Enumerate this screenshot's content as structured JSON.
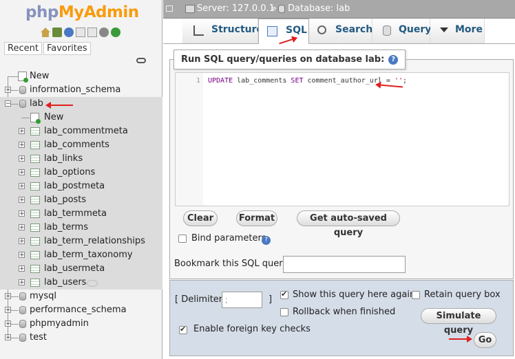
{
  "logo": {
    "part1": "php",
    "part2": "MyAdmin"
  },
  "nav": {
    "recent_label": "Recent",
    "favorites_label": "Favorites",
    "tree": [
      {
        "label": "New",
        "kind": "new",
        "level": 0
      },
      {
        "label": "information_schema",
        "kind": "db",
        "level": 0
      },
      {
        "label": "lab",
        "kind": "db",
        "level": 0,
        "selected": true
      },
      {
        "label": "New",
        "kind": "new",
        "level": 1
      },
      {
        "label": "lab_commentmeta",
        "kind": "table",
        "level": 1
      },
      {
        "label": "lab_comments",
        "kind": "table",
        "level": 1
      },
      {
        "label": "lab_links",
        "kind": "table",
        "level": 1
      },
      {
        "label": "lab_options",
        "kind": "table",
        "level": 1
      },
      {
        "label": "lab_postmeta",
        "kind": "table",
        "level": 1
      },
      {
        "label": "lab_posts",
        "kind": "table",
        "level": 1
      },
      {
        "label": "lab_termmeta",
        "kind": "table",
        "level": 1
      },
      {
        "label": "lab_terms",
        "kind": "table",
        "level": 1
      },
      {
        "label": "lab_term_relationships",
        "kind": "table",
        "level": 1
      },
      {
        "label": "lab_term_taxonomy",
        "kind": "table",
        "level": 1
      },
      {
        "label": "lab_usermeta",
        "kind": "table",
        "level": 1
      },
      {
        "label": "lab_users",
        "kind": "table",
        "level": 1
      },
      {
        "label": "mysql",
        "kind": "db",
        "level": 0
      },
      {
        "label": "performance_schema",
        "kind": "db",
        "level": 0
      },
      {
        "label": "phpmyadmin",
        "kind": "db",
        "level": 0
      },
      {
        "label": "test",
        "kind": "db",
        "level": 0
      }
    ]
  },
  "breadcrumb": {
    "server": "Server: 127.0.0.1",
    "separator": "»",
    "database": "Database: lab"
  },
  "tabs": [
    {
      "label": "Structure",
      "icon": "structure-icon"
    },
    {
      "label": "SQL",
      "icon": "sql-icon",
      "active": true
    },
    {
      "label": "Search",
      "icon": "search-icon"
    },
    {
      "label": "Query",
      "icon": "query-icon"
    },
    {
      "label": "More",
      "icon": "caret-down-icon"
    }
  ],
  "sql": {
    "legend": "Run SQL query/queries on database lab:",
    "line_number": "1",
    "code_keyword1": "UPDATE",
    "code_part1": " lab_comments ",
    "code_keyword2": "SET",
    "code_part2": " comment_author_url = ",
    "code_string": "''",
    "code_end": ";",
    "clear_label": "Clear",
    "format_label": "Format",
    "autosave_label": "Get auto-saved query",
    "bind_label": "Bind parameters",
    "bookmark_label": "Bookmark this SQL query:",
    "bookmark_value": ""
  },
  "options": {
    "delimiter_label": "[ Delimiter",
    "delimiter_close": "]",
    "delimiter_value": ";",
    "show_query_label": "Show this query here again",
    "show_query_checked": true,
    "retain_label": "Retain query box",
    "retain_checked": false,
    "rollback_label": "Rollback when finished",
    "rollback_checked": false,
    "foreign_label": "Enable foreign key checks",
    "foreign_checked": true,
    "simulate_label": "Simulate query",
    "go_label": "Go"
  },
  "colors": {
    "accent": "#235a81",
    "annotation": "#e02020",
    "options_bg": "#d5dde8"
  }
}
